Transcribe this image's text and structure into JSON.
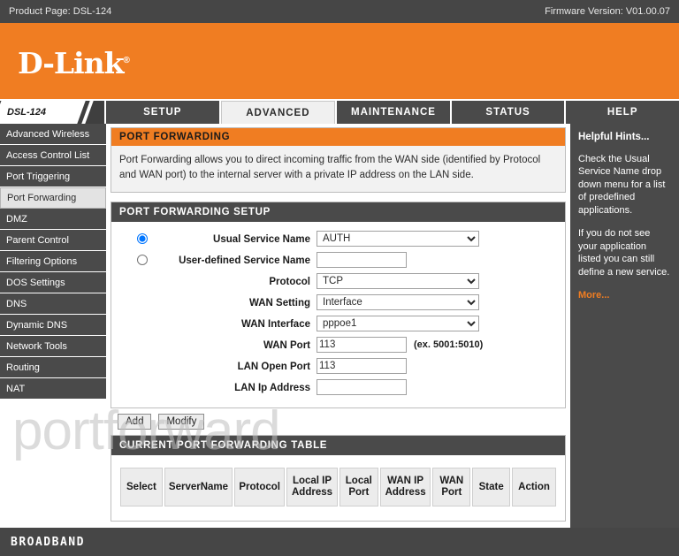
{
  "topbar": {
    "product_page": "Product Page: DSL-124",
    "firmware": "Firmware Version: V01.00.07"
  },
  "brand": {
    "logo_text": "D-Link",
    "registered_mark": "®"
  },
  "nav": {
    "model": "DSL-124",
    "tabs": [
      {
        "label": "SETUP",
        "active": false
      },
      {
        "label": "ADVANCED",
        "active": true
      },
      {
        "label": "MAINTENANCE",
        "active": false
      },
      {
        "label": "STATUS",
        "active": false
      },
      {
        "label": "HELP",
        "active": false
      }
    ]
  },
  "sidebar": {
    "items": [
      {
        "label": "Advanced Wireless",
        "active": false
      },
      {
        "label": "Access Control List",
        "active": false
      },
      {
        "label": "Port Triggering",
        "active": false
      },
      {
        "label": "Port Forwarding",
        "active": true
      },
      {
        "label": "DMZ",
        "active": false
      },
      {
        "label": "Parent Control",
        "active": false
      },
      {
        "label": "Filtering Options",
        "active": false
      },
      {
        "label": "DOS Settings",
        "active": false
      },
      {
        "label": "DNS",
        "active": false
      },
      {
        "label": "Dynamic DNS",
        "active": false
      },
      {
        "label": "Network Tools",
        "active": false
      },
      {
        "label": "Routing",
        "active": false
      },
      {
        "label": "NAT",
        "active": false
      }
    ]
  },
  "main": {
    "header": "PORT FORWARDING",
    "description": "Port Forwarding allows you to direct incoming traffic from the WAN side (identified by Protocol and WAN port) to the internal server with a private IP address on the LAN side.",
    "setup_header": "PORT FORWARDING SETUP",
    "form": {
      "usual_service_name_label": "Usual Service Name",
      "usual_service_name_value": "AUTH",
      "usual_service_name_selected": true,
      "user_defined_label": "User-defined Service Name",
      "user_defined_value": "",
      "user_defined_selected": false,
      "protocol_label": "Protocol",
      "protocol_value": "TCP",
      "wan_setting_label": "WAN Setting",
      "wan_setting_value": "Interface",
      "wan_interface_label": "WAN Interface",
      "wan_interface_value": "pppoe1",
      "wan_port_label": "WAN Port",
      "wan_port_value": "113",
      "wan_port_hint": "(ex. 5001:5010)",
      "lan_open_port_label": "LAN Open Port",
      "lan_open_port_value": "113",
      "lan_ip_label": "LAN Ip Address",
      "lan_ip_value": ""
    },
    "buttons": {
      "add": "Add",
      "modify": "Modify"
    },
    "table_header": "CURRENT PORT FORWARDING TABLE",
    "table_columns": [
      "Select",
      "ServerName",
      "Protocol",
      "Local IP Address",
      "Local Port",
      "WAN IP Address",
      "WAN Port",
      "State",
      "Action"
    ],
    "table_rows": []
  },
  "hints": {
    "title": "Helpful Hints...",
    "paragraph1": "Check the Usual Service Name drop down menu for a list of predefined applications.",
    "paragraph2": "If you do not see your application listed you can still define a new service.",
    "more": "More..."
  },
  "footer": {
    "label": "BROADBAND"
  },
  "watermark": {
    "text": "portforward"
  }
}
